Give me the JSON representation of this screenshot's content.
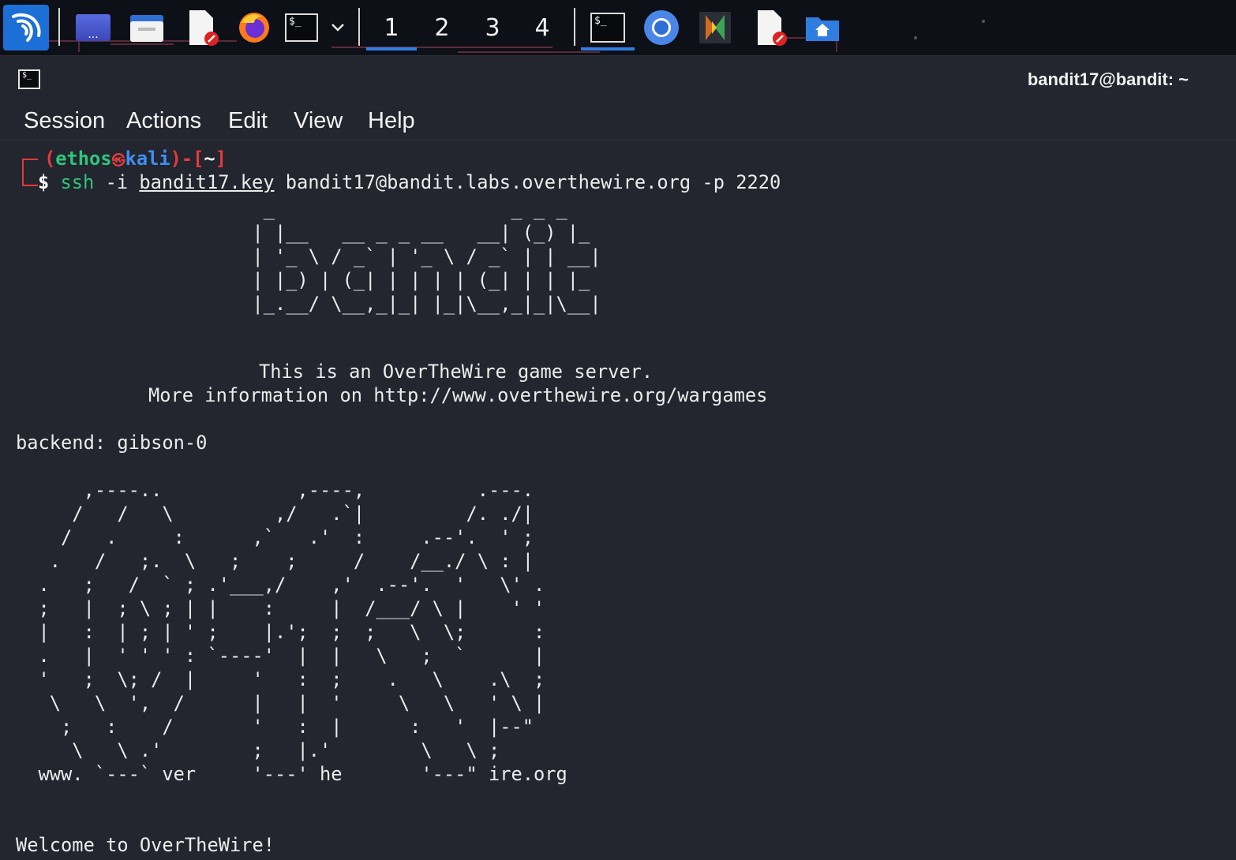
{
  "taskbar": {
    "workspaces": [
      "1",
      "2",
      "3",
      "4"
    ],
    "active_workspace": "1",
    "apps": [
      {
        "name": "kali-menu-icon"
      },
      {
        "name": "desktop-icon"
      },
      {
        "name": "file-manager-icon"
      },
      {
        "name": "text-editor-icon"
      },
      {
        "name": "firefox-icon"
      },
      {
        "name": "terminal-icon"
      },
      {
        "name": "chevron-down-icon"
      },
      {
        "name": "terminal-window-icon"
      },
      {
        "name": "chromium-icon"
      },
      {
        "name": "kate-icon"
      },
      {
        "name": "text-editor-2-icon"
      },
      {
        "name": "home-folder-icon"
      }
    ],
    "desktop_label": "...",
    "terminal_glyph": "$_"
  },
  "window": {
    "title": "bandit17@bandit: ~",
    "icon_glyph": "$_"
  },
  "menu": [
    "Session",
    "Actions",
    "Edit",
    "View",
    "Help"
  ],
  "prompt": {
    "open": "┌──(",
    "user": "ethos",
    "at": "㉿",
    "host": "kali",
    "close": ")-[",
    "dir": "~",
    "end": "]",
    "dollar": "$",
    "cmd": "ssh",
    "flag": " -i ",
    "keyfile": "bandit17.key",
    "args": " bandit17@bandit.labs.overthewire.org -p 2220"
  },
  "banner_ascii": "                      _                     _ _ _   \n                     | |__   __ _ _ __   __| (_) |_ \n                     | '_ \\ / _` | '_ \\ / _` | | __|\n                     | |_) | (_| | | | | (_| | | |_ \n                     |_.__/ \\__,_|_| |_|\\__,_|_|\\__|",
  "info_line1": "This is an OverTheWire game server.",
  "info_line2": "More information on http://www.overthewire.org/wargames",
  "backend": "backend: gibson-0",
  "otw_ascii": "      ,----..            ,----,          .---.\n     /   /   \\         ,/   .`|         /. ./|\n    /   .     :      ,`   .'  :     .--'.  ' ;\n   .   /   ;.  \\   ;    ;     /    /__./ \\ : |\n  .   ;   /  ` ; .'___,/    ,'  .--'.  '   \\' .\n  ;   |  ; \\ ; | |    :     |  /___/ \\ |    ' '\n  |   :  | ; | ' ;    |.';  ;  ;   \\  \\;      :\n  .   |  ' ' ' : `----'  |  |   \\   ;  `      |\n  '   ;  \\; /  |     '   :  ;    .   \\    .\\  ;\n   \\   \\  ',  /      |   |  '     \\   \\   ' \\ |\n    ;   :    /       '   :  |      :   '  |--\"\n     \\   \\ .'        ;   |.'        \\   \\ ;\n  www. `---` ver     '---' he       '---\" ire.org",
  "welcome": "Welcome to OverTheWire!"
}
